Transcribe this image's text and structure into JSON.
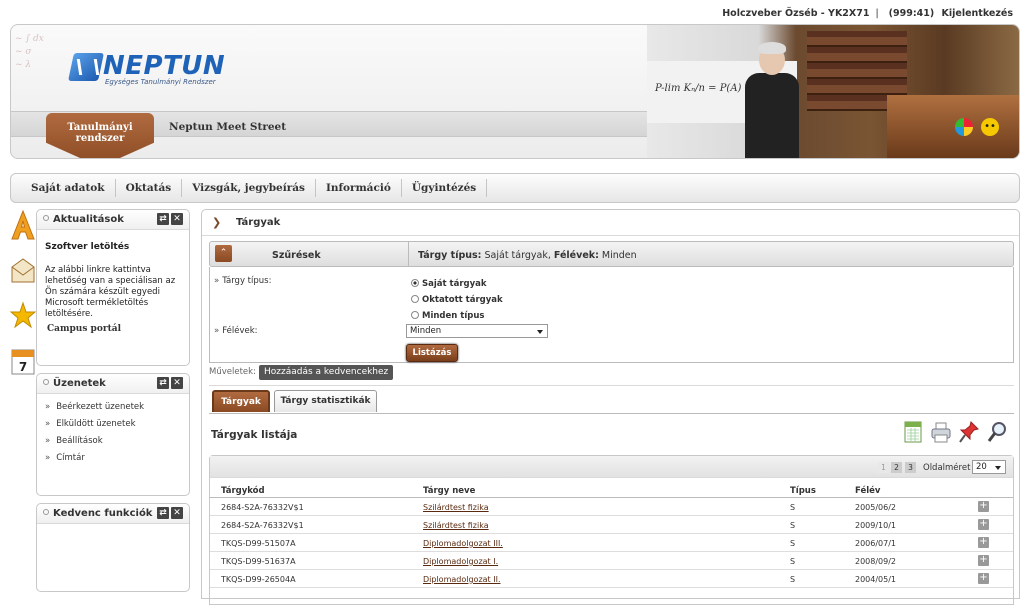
{
  "topbar": {
    "user": "Holczveber Özséb - YK2X71",
    "separator": "|",
    "session": "(999:41)",
    "logout": "Kijelentkezés"
  },
  "header": {
    "logo_name": "NEPTUN",
    "logo_sub": "Egységes Tanulmányi Rendszer",
    "tab_active": "Tanulmányi rendszer",
    "tab_meet": "Neptun Meet Street"
  },
  "menu": {
    "items": [
      "Saját adatok",
      "Oktatás",
      "Vizsgák, jegybeírás",
      "Információ",
      "Ügyintézés"
    ]
  },
  "side_icons": [
    "a-letter-icon",
    "envelope-icon",
    "star-icon",
    "calendar-icon"
  ],
  "calendar_day": "7",
  "news": {
    "title": "Aktualitások",
    "item_title": "Szoftver letöltés",
    "item_text": "Az alábbi linkre kattintva lehetőség van a speciálisan az Ön számára készült egyedi Microsoft termékletöltés letöltésére.",
    "item_text_display": [
      "Az alábbi linkre kattintva",
      "lehetőség van a speciálisan az",
      "Ön számára készült egyedi",
      "Microsoft termékletöltés",
      "letöltésére."
    ],
    "link": "Campus portál"
  },
  "messages": {
    "title": "Üzenetek",
    "items": [
      "Beérkezett üzenetek",
      "Elküldött üzenetek",
      "Beállítások",
      "Címtár"
    ]
  },
  "favorites": {
    "title": "Kedvenc funkciók"
  },
  "main": {
    "title": "Tárgyak",
    "filter_label": "Szűrések",
    "filter_summary_type_label": "Tárgy típus:",
    "filter_summary_type_value": "Saját tárgyak,",
    "filter_summary_sem_label": "Félévek:",
    "filter_summary_sem_value": "Minden",
    "type_label": "Tárgy típus:",
    "radio_options": [
      "Saját tárgyak",
      "Oktatott tárgyak",
      "Minden típus"
    ],
    "radio_selected": 0,
    "semester_label": "Félévek:",
    "semester_value": "Minden",
    "list_button": "Listázás",
    "ops_label": "Műveletek:",
    "fav_button": "Hozzáadás a kedvencekhez",
    "tabs": [
      "Tárgyak",
      "Tárgy statisztikák"
    ],
    "list_title": "Tárgyak listája",
    "tool_icons": [
      "excel-icon",
      "print-icon",
      "pin-icon",
      "search-icon"
    ]
  },
  "grid": {
    "pages": [
      "1",
      "2",
      "3"
    ],
    "current_page": "1",
    "page_size_label": "Oldalméret",
    "page_size": "20",
    "headers": [
      "Tárgykód",
      "Tárgy neve",
      "Típus",
      "Félév"
    ],
    "rows": [
      [
        "2684-S2A-76332V$1",
        "Szilárdtest fizika",
        "S",
        "2005/06/2"
      ],
      [
        "2684-S2A-76332V$1",
        "Szilárdtest fizika",
        "S",
        "2009/10/1"
      ],
      [
        "TKQS-D99-51507A",
        "Diplomadolgozat III.",
        "S",
        "2006/07/1"
      ],
      [
        "TKQS-D99-51637A",
        "Diplomadolgozat I.",
        "S",
        "2008/09/2"
      ],
      [
        "TKQS-D99-26504A",
        "Diplomadolgozat II.",
        "S",
        "2004/05/1"
      ]
    ]
  }
}
